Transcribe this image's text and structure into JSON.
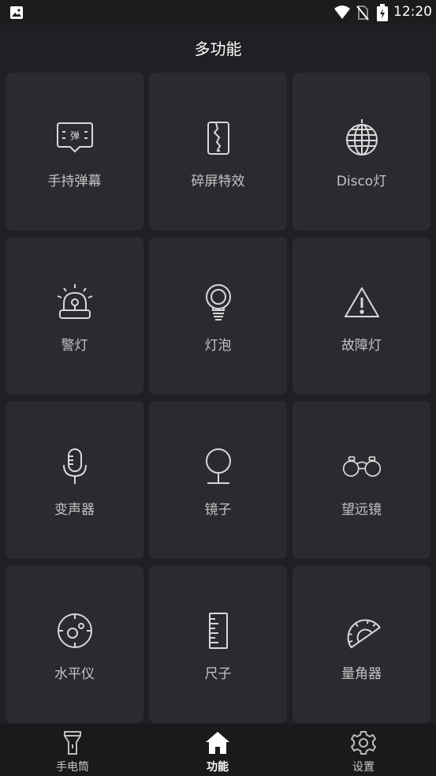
{
  "status_bar": {
    "time": "12:20"
  },
  "header": {
    "title": "多功能"
  },
  "tiles": [
    {
      "label": "手持弹幕",
      "icon": "bullet-comment-icon",
      "icon_text": "弹"
    },
    {
      "label": "碎屏特效",
      "icon": "cracked-phone-icon"
    },
    {
      "label": "Disco灯",
      "icon": "disco-ball-icon"
    },
    {
      "label": "警灯",
      "icon": "siren-icon"
    },
    {
      "label": "灯泡",
      "icon": "light-bulb-icon"
    },
    {
      "label": "故障灯",
      "icon": "warning-triangle-icon"
    },
    {
      "label": "变声器",
      "icon": "microphone-icon"
    },
    {
      "label": "镜子",
      "icon": "mirror-icon"
    },
    {
      "label": "望远镜",
      "icon": "binoculars-icon"
    },
    {
      "label": "水平仪",
      "icon": "level-gauge-icon"
    },
    {
      "label": "尺子",
      "icon": "ruler-icon"
    },
    {
      "label": "量角器",
      "icon": "protractor-icon"
    }
  ],
  "bottom_nav": [
    {
      "label": "手电筒",
      "icon": "flashlight-icon",
      "active": false
    },
    {
      "label": "功能",
      "icon": "home-icon",
      "active": true
    },
    {
      "label": "设置",
      "icon": "gear-icon",
      "active": false
    }
  ],
  "colors": {
    "background": "#202024",
    "tile": "#2a2b30",
    "nav_background": "#1a1a1d",
    "text": "#c4c4c4",
    "title": "#ffffff"
  }
}
